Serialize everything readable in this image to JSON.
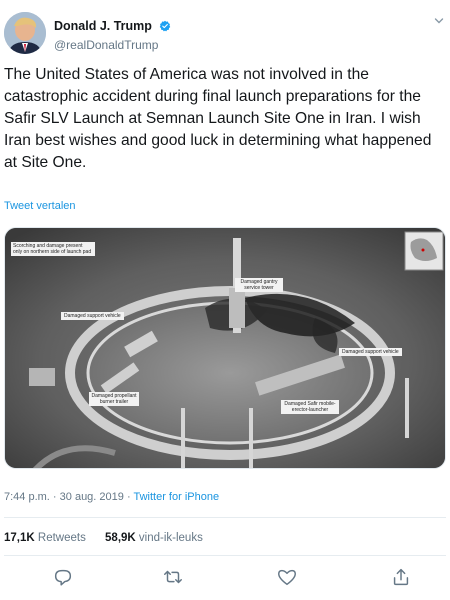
{
  "author": {
    "display_name": "Donald J. Trump",
    "handle": "@realDonaldTrump",
    "verified": true
  },
  "tweet": {
    "text": "The United States of America was not involved in the catastrophic accident during final launch preparations for the Safir SLV Launch at Semnan Launch Site One in Iran. I wish Iran best wishes and good luck in determining what happened at Site One.",
    "translate_label": "Tweet vertalen"
  },
  "media": {
    "labels": {
      "scorching": "Scorching and damage present only on northern side of launch pad",
      "gantry": "Damaged gantry service tower",
      "support_vehicle_left": "Damaged support vehicle",
      "support_vehicle_right": "Damaged support vehicle",
      "propellant_trailer": "Damaged propellant burner trailer",
      "erector_launcher": "Damaged Safir mobile-erector-launcher"
    }
  },
  "meta": {
    "time": "7:44 p.m.",
    "date": "30 aug. 2019",
    "separator": "·",
    "source": "Twitter for iPhone"
  },
  "stats": {
    "retweets_count": "17,1K",
    "retweets_label": "Retweets",
    "likes_count": "58,9K",
    "likes_label": "vind-ik-leuks"
  },
  "icons": {
    "reply": "reply-icon",
    "retweet": "retweet-icon",
    "like": "like-icon",
    "share": "share-icon",
    "verified": "verified-badge-icon",
    "caret": "chevron-down-icon"
  },
  "colors": {
    "link": "#1b95e0",
    "muted": "#657786",
    "text": "#14171a",
    "verified": "#1da1f2"
  }
}
